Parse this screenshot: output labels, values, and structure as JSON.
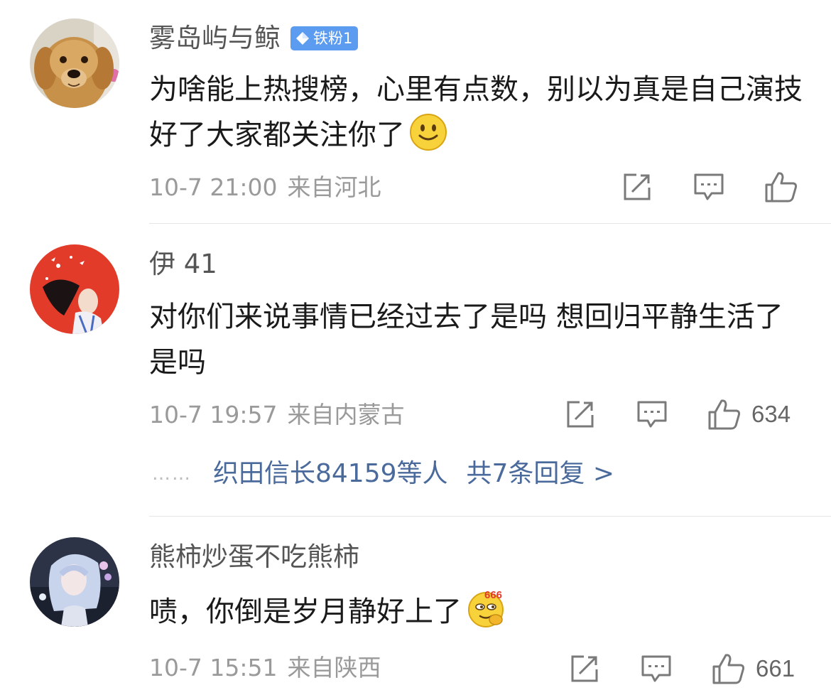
{
  "comments": [
    {
      "username": "雾岛屿与鲸",
      "badge": "铁粉1",
      "text": "为啥能上热搜榜，心里有点数，别以为真是自己演技好了大家都关注你了",
      "emoji": "smile-emoji",
      "time": "10-7 21:00",
      "location": "来自河北",
      "likes": ""
    },
    {
      "username": "伊 41",
      "text": "对你们来说事情已经过去了是吗 想回归平静生活了是吗",
      "time": "10-7 19:57",
      "location": "来自内蒙古",
      "likes": "634",
      "replies": {
        "dots": "……",
        "text": "织田信长84159等人",
        "total": "共7条回复 >"
      }
    },
    {
      "username": "熊柿炒蛋不吃熊柿",
      "text": "啧，你倒是岁月静好上了",
      "emoji": "666-emoji",
      "time": "10-7 15:51",
      "location": "来自陕西",
      "likes": "661"
    }
  ],
  "icons": {
    "repost": "repost-icon",
    "comment": "comment-icon",
    "like": "thumbs-up-icon"
  },
  "colors": {
    "badge": "#5b9bf0",
    "link": "#4a6a9c",
    "meta": "#9a9a9a"
  }
}
